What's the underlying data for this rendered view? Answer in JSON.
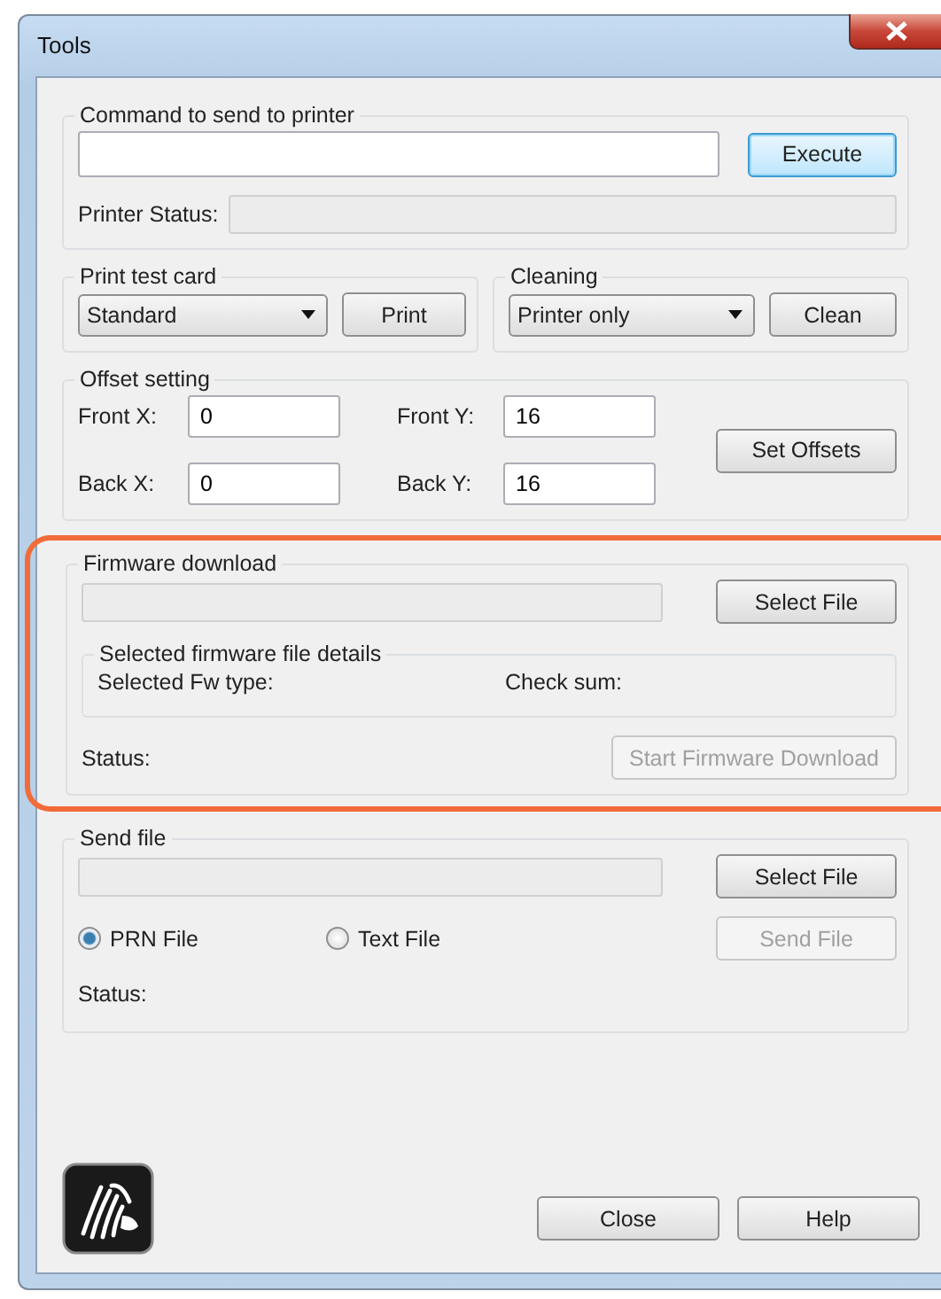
{
  "window": {
    "title": "Tools"
  },
  "command": {
    "legend": "Command to send to printer",
    "execute": {
      "label": "Execute",
      "default": true,
      "disabled": false
    },
    "status_label": "Printer Status:"
  },
  "print_test": {
    "legend": "Print test card",
    "select": "Standard",
    "button": {
      "label": "Print",
      "default": false,
      "disabled": false
    }
  },
  "cleaning": {
    "legend": "Cleaning",
    "select": "Printer only",
    "button": {
      "label": "Clean",
      "default": false,
      "disabled": false
    }
  },
  "offset": {
    "legend": "Offset setting",
    "fields": [
      {
        "label": "Front X:",
        "value": "0"
      },
      {
        "label": "Front Y:",
        "value": "16"
      },
      {
        "label": "Back X:",
        "value": "0"
      },
      {
        "label": "Back Y:",
        "value": "16"
      }
    ],
    "button": {
      "label": "Set Offsets",
      "default": false,
      "disabled": false
    }
  },
  "firmware": {
    "highlighted": true,
    "legend": "Firmware download",
    "select_button": {
      "label": "Select File",
      "default": false,
      "disabled": false
    },
    "details": {
      "legend": "Selected firmware file details",
      "type_label": "Selected Fw type:",
      "checksum_label": "Check sum:"
    },
    "status_label": "Status:",
    "start_button": {
      "label": "Start Firmware Download",
      "default": false,
      "disabled": true
    }
  },
  "send_file": {
    "legend": "Send file",
    "select_button": {
      "label": "Select File",
      "default": false,
      "disabled": false
    },
    "radios": [
      {
        "label": "PRN File",
        "selected": true
      },
      {
        "label": "Text File",
        "selected": false
      }
    ],
    "send_button": {
      "label": "Send File",
      "default": false,
      "disabled": true
    },
    "status_label": "Status:"
  },
  "footer": {
    "buttons": [
      {
        "label": "Close",
        "default": false,
        "disabled": false
      },
      {
        "label": "Help",
        "default": false,
        "disabled": false
      }
    ]
  }
}
